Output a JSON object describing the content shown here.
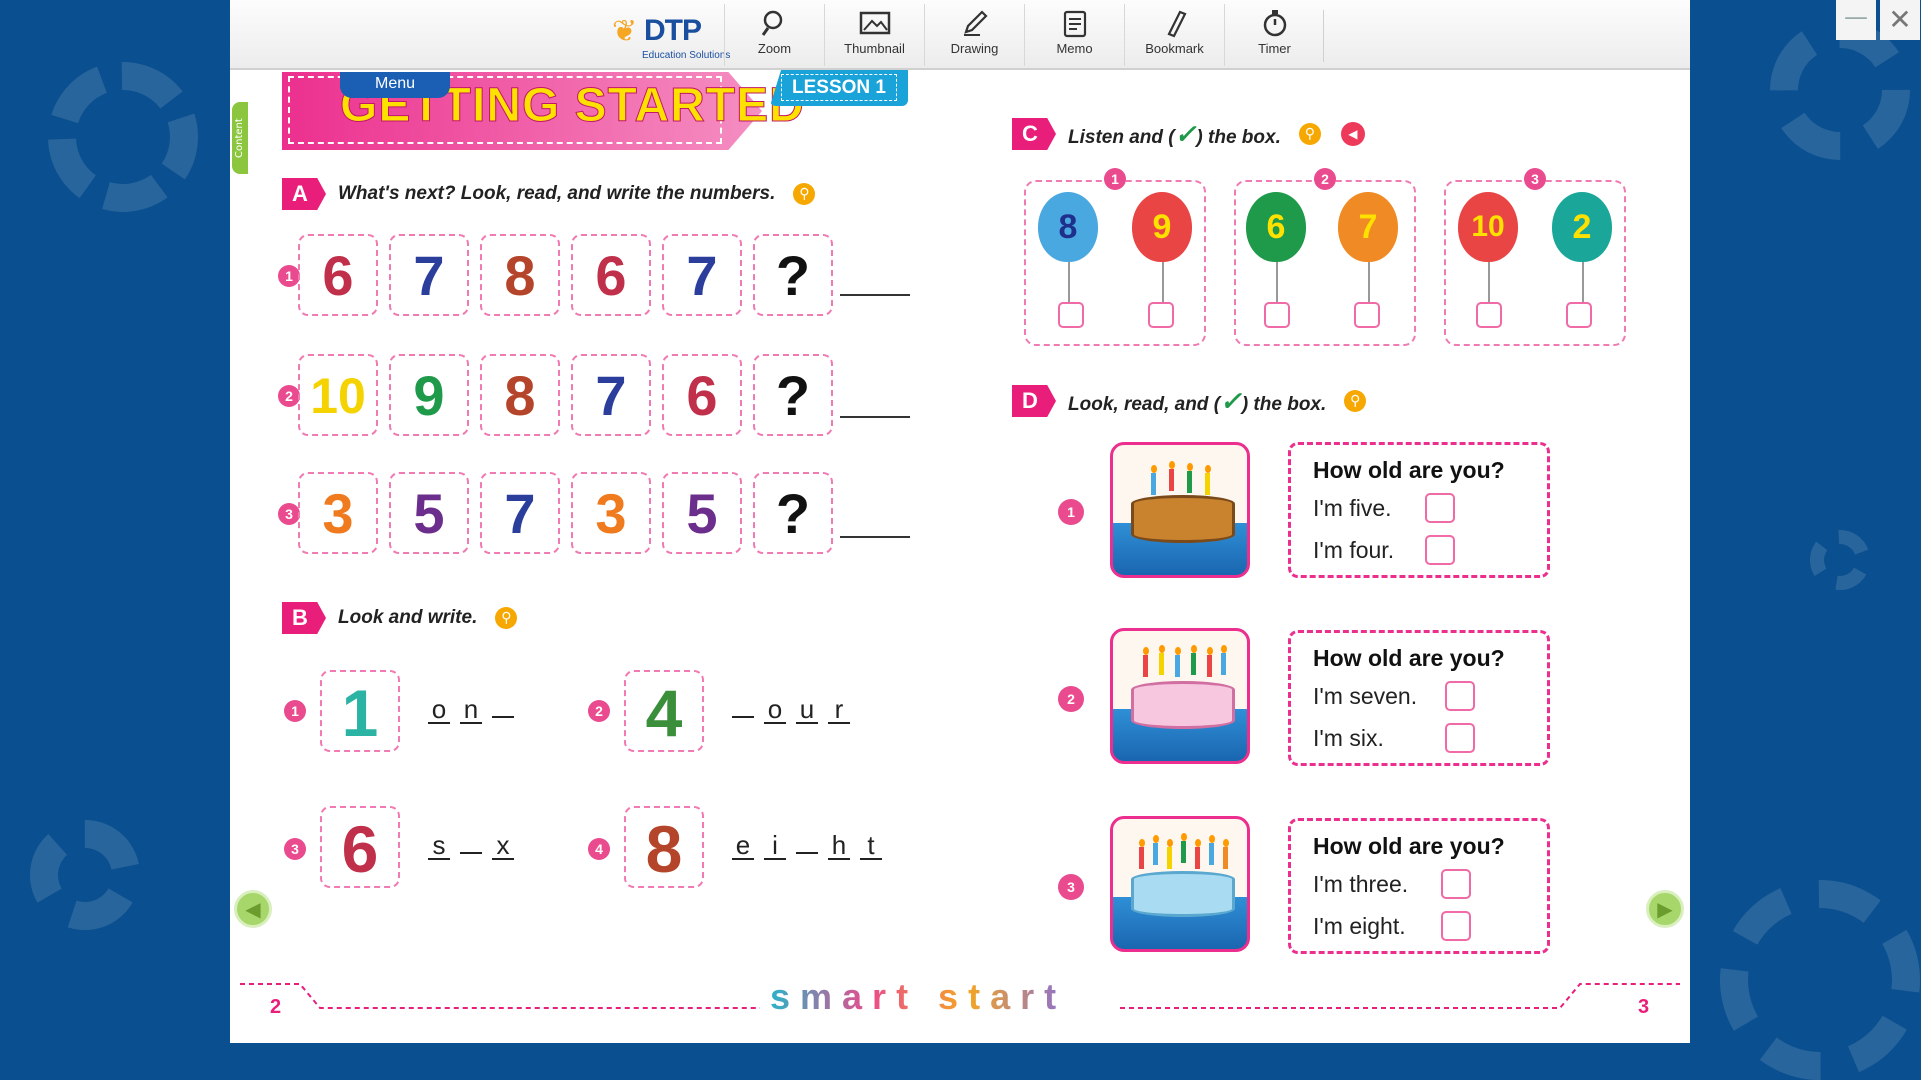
{
  "window": {
    "minimize_label": "—",
    "close_label": "✕"
  },
  "toolbar": {
    "logo_big": "DTP",
    "logo_small": "Education Solutions",
    "tools": [
      {
        "label": "Zoom",
        "icon": "zoom-icon"
      },
      {
        "label": "Thumbnail",
        "icon": "thumbnail-icon"
      },
      {
        "label": "Drawing",
        "icon": "pencil-icon"
      },
      {
        "label": "Memo",
        "icon": "memo-icon"
      },
      {
        "label": "Bookmark",
        "icon": "bookmark-icon"
      },
      {
        "label": "Timer",
        "icon": "timer-icon"
      }
    ]
  },
  "sidebar": {
    "content_tab": "Content"
  },
  "header": {
    "menu": "Menu",
    "title": "GETTING STARTED",
    "lesson": "LESSON 1"
  },
  "sectionA": {
    "badge": "A",
    "instruction": "What's next? Look, read, and write the numbers.",
    "rows": [
      {
        "num": "1",
        "items": [
          "6",
          "7",
          "8",
          "6",
          "7",
          "?"
        ]
      },
      {
        "num": "2",
        "items": [
          "10",
          "9",
          "8",
          "7",
          "6",
          "?"
        ]
      },
      {
        "num": "3",
        "items": [
          "3",
          "5",
          "7",
          "3",
          "5",
          "?"
        ]
      }
    ]
  },
  "sectionB": {
    "badge": "B",
    "instruction": "Look and write.",
    "items": [
      {
        "num": "1",
        "digit": "1",
        "letters": [
          "o",
          "n",
          ""
        ]
      },
      {
        "num": "2",
        "digit": "4",
        "letters": [
          "",
          "o",
          "u",
          "r"
        ]
      },
      {
        "num": "3",
        "digit": "6",
        "letters": [
          "s",
          "",
          "x"
        ]
      },
      {
        "num": "4",
        "digit": "8",
        "letters": [
          "e",
          "i",
          "",
          "h",
          "t"
        ]
      }
    ]
  },
  "sectionC": {
    "badge": "C",
    "instruction_pre": "Listen and (",
    "check": "✓",
    "instruction_post": ") the box.",
    "groups": [
      {
        "num": "1",
        "balloons": [
          "8",
          "9"
        ]
      },
      {
        "num": "2",
        "balloons": [
          "6",
          "7"
        ]
      },
      {
        "num": "3",
        "balloons": [
          "10",
          "2"
        ]
      }
    ]
  },
  "sectionD": {
    "badge": "D",
    "instruction_pre": "Look, read, and (",
    "check": "✓",
    "instruction_post": ") the box.",
    "items": [
      {
        "num": "1",
        "question": "How old are you?",
        "a1": "I'm five.",
        "a2": "I'm four."
      },
      {
        "num": "2",
        "question": "How old are you?",
        "a1": "I'm seven.",
        "a2": "I'm six."
      },
      {
        "num": "3",
        "question": "How old are you?",
        "a1": "I'm three.",
        "a2": "I'm eight."
      }
    ]
  },
  "footer": {
    "brand": "smart start",
    "page_left": "2",
    "page_right": "3"
  },
  "colors": {
    "accent": "#e91e7a",
    "balloons": {
      "8": "#4aa8e0",
      "9": "#e94545",
      "6": "#1f9a4a",
      "7": "#f08a24",
      "10": "#e94545",
      "2": "#1aa79a"
    }
  }
}
